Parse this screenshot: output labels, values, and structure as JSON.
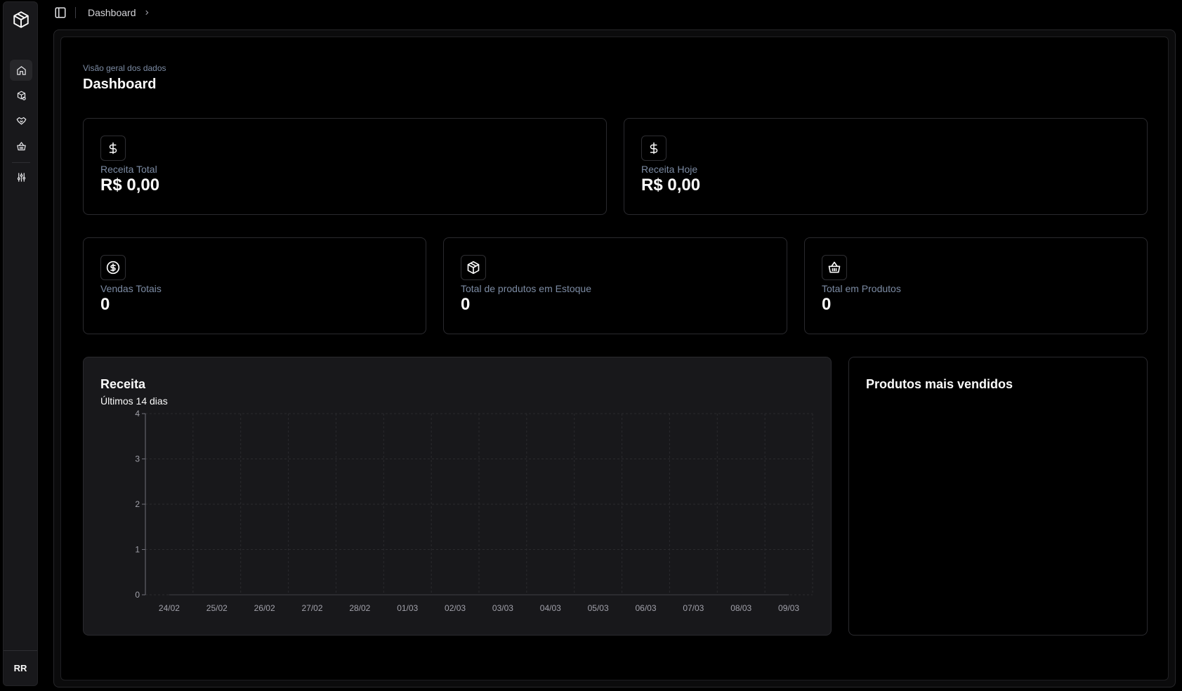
{
  "user": {
    "initials": "RR"
  },
  "breadcrumb": {
    "current": "Dashboard"
  },
  "header": {
    "subtitle": "Visão geral dos dados",
    "title": "Dashboard"
  },
  "stats": {
    "receita_total": {
      "label": "Receita Total",
      "value": "R$ 0,00",
      "icon": "dollar-icon"
    },
    "receita_hoje": {
      "label": "Receita Hoje",
      "value": "R$ 0,00",
      "icon": "dollar-icon"
    },
    "vendas_totais": {
      "label": "Vendas Totais",
      "value": "0",
      "icon": "circle-dollar-icon"
    },
    "produtos_estoque": {
      "label": "Total de produtos em Estoque",
      "value": "0",
      "icon": "package-icon"
    },
    "total_produtos": {
      "label": "Total em Produtos",
      "value": "0",
      "icon": "basket-icon"
    }
  },
  "revenue_chart": {
    "title": "Receita",
    "subtitle": "Últimos 14 dias"
  },
  "top_products": {
    "title": "Produtos mais vendidos"
  },
  "nav": [
    "home-icon",
    "packages-icon",
    "handshake-icon",
    "basket-icon",
    "settings-sliders-icon"
  ],
  "colors": {
    "accent_label": "#7c8ba3",
    "card_bg": "#18181b",
    "border": "#2a2a2e"
  },
  "chart_data": {
    "type": "area",
    "title": "Receita",
    "subtitle": "Últimos 14 dias",
    "categories": [
      "24/02",
      "25/02",
      "26/02",
      "27/02",
      "28/02",
      "01/03",
      "02/03",
      "03/03",
      "04/03",
      "05/03",
      "06/03",
      "07/03",
      "08/03",
      "09/03"
    ],
    "values": [
      0,
      0,
      0,
      0,
      0,
      0,
      0,
      0,
      0,
      0,
      0,
      0,
      0,
      0
    ],
    "yticks": [
      0,
      1,
      2,
      3,
      4
    ],
    "ylim": [
      0,
      4
    ],
    "grid": true
  }
}
